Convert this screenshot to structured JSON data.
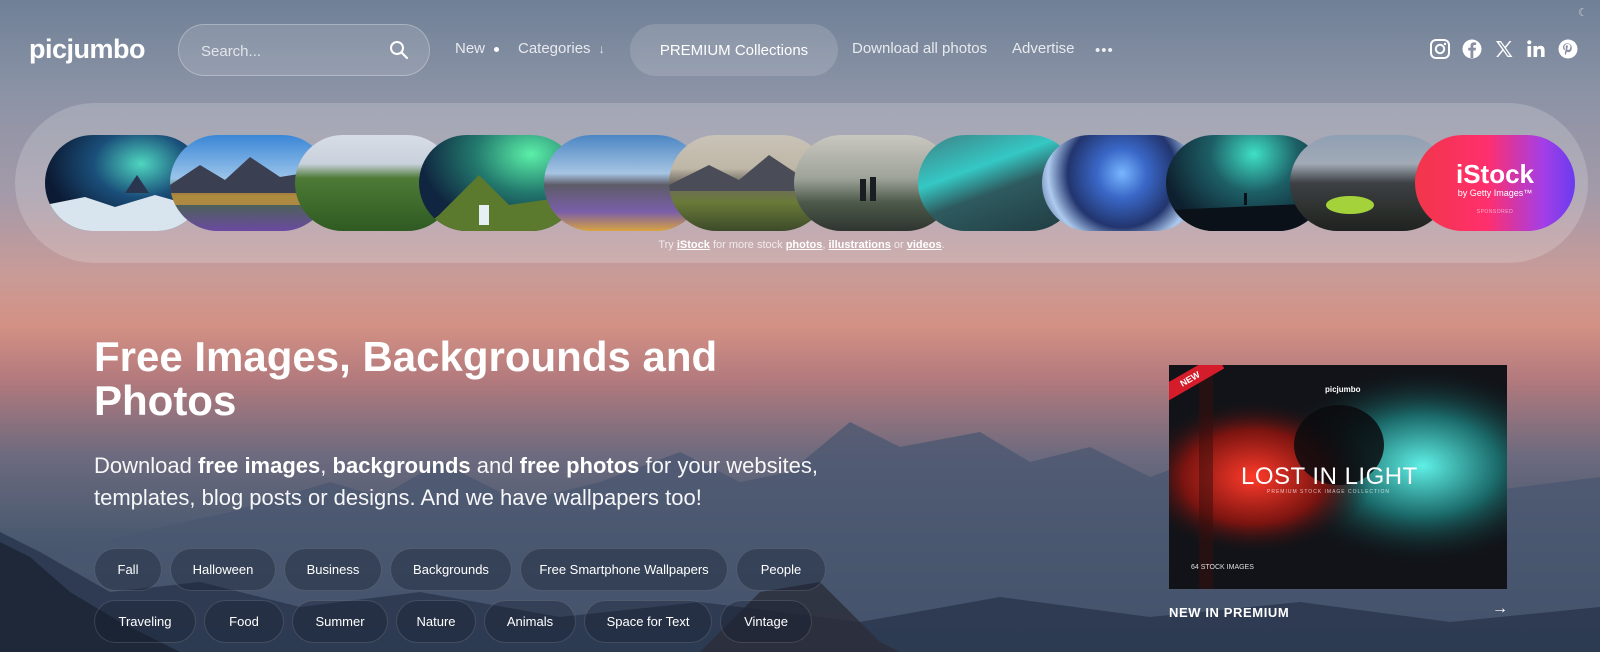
{
  "header": {
    "logo": "picjumbo",
    "search_placeholder": "Search...",
    "nav": {
      "new": "New",
      "categories": "Categories",
      "premium": "PREMIUM Collections",
      "download_all": "Download all photos",
      "advertise": "Advertise",
      "more": "•••"
    },
    "social_icons": [
      "instagram-icon",
      "facebook-icon",
      "x-icon",
      "linkedin-icon",
      "pinterest-icon"
    ]
  },
  "carousel": {
    "istock_title": "iStock",
    "istock_sub": "by Getty Images™",
    "istock_sponsored": "SPONSORED",
    "try_prefix": "Try",
    "try_brand": "iStock",
    "try_mid": "for more stock",
    "try_photos": "photos",
    "try_comma": ",",
    "try_illustrations": "illustrations",
    "try_or": "or",
    "try_videos": "videos",
    "try_end": "."
  },
  "hero": {
    "title": "Free Images, Backgrounds and Photos",
    "sub_1": "Download",
    "sub_b1": "free images",
    "sub_2": ",",
    "sub_b2": "backgrounds",
    "sub_3": "and",
    "sub_b3": "free photos",
    "sub_4": "for your websites, templates, blog posts or designs. And we have wallpapers too!"
  },
  "tags": [
    "Fall",
    "Halloween",
    "Business",
    "Backgrounds",
    "Free Smartphone Wallpapers",
    "People",
    "Traveling",
    "Food",
    "Summer",
    "Nature",
    "Animals",
    "Space for Text",
    "Vintage"
  ],
  "premium_card": {
    "badge": "NEW",
    "brand": "picjumbo",
    "title": "LOST IN LIGHT",
    "subtitle": "PREMIUM STOCK IMAGE COLLECTION",
    "count": "64 STOCK IMAGES",
    "caption": "NEW IN PREMIUM",
    "arrow": "→"
  }
}
